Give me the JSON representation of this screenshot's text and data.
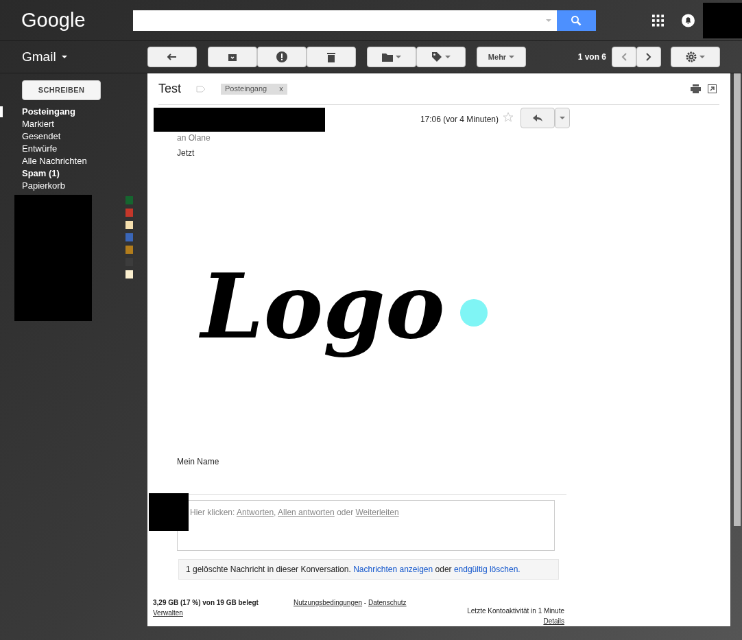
{
  "header": {
    "logo": "Google"
  },
  "toolbar": {
    "app": "Gmail",
    "more": "Mehr",
    "pager": "1 von 6"
  },
  "sidebar": {
    "compose": "SCHREIBEN",
    "items": [
      {
        "label": "Posteingang",
        "selected": true,
        "bold": true
      },
      {
        "label": "Markiert",
        "selected": false,
        "bold": false
      },
      {
        "label": "Gesendet",
        "selected": false,
        "bold": false
      },
      {
        "label": "Entwürfe",
        "selected": false,
        "bold": false
      },
      {
        "label": "Alle Nachrichten",
        "selected": false,
        "bold": false
      },
      {
        "label": "Spam (1)",
        "selected": false,
        "bold": true
      },
      {
        "label": "Papierkorb",
        "selected": false,
        "bold": false
      }
    ],
    "labels": [
      {
        "color": "#16652f"
      },
      {
        "color": "#c5372a"
      },
      {
        "color": "#f5dfae"
      },
      {
        "color": "#3a66b8"
      },
      {
        "color": "#b27d1c"
      },
      {
        "color": "#3c3c3c"
      },
      {
        "color": "#fbefcf"
      }
    ]
  },
  "message": {
    "subject": "Test",
    "tag": "Posteingang",
    "tag_close": "x",
    "time": "17:06 (vor 4 Minuten)",
    "recipient": "an Olane",
    "body_top": "Jetzt",
    "logo_image_text": "Logo",
    "signature": "Mein Name"
  },
  "reply": {
    "prefix": "Hier klicken: ",
    "links": [
      "Antworten,",
      "Allen antworten",
      "Weiterleiten"
    ],
    "joiner": " oder "
  },
  "deleted_notice": {
    "text": "1 gelöschte Nachricht in dieser Konversation.",
    "link1": "Nachrichten anzeigen",
    "joiner": " oder ",
    "link2": "endgültig löschen."
  },
  "footer": {
    "storage": "3,29 GB (17 %) von 19 GB belegt",
    "manage": "Verwalten",
    "terms": "Nutzungsbedingungen",
    "sep": " - ",
    "privacy": "Datenschutz",
    "activity": "Letzte Kontoaktivität in 1 Minute",
    "details": "Details"
  }
}
